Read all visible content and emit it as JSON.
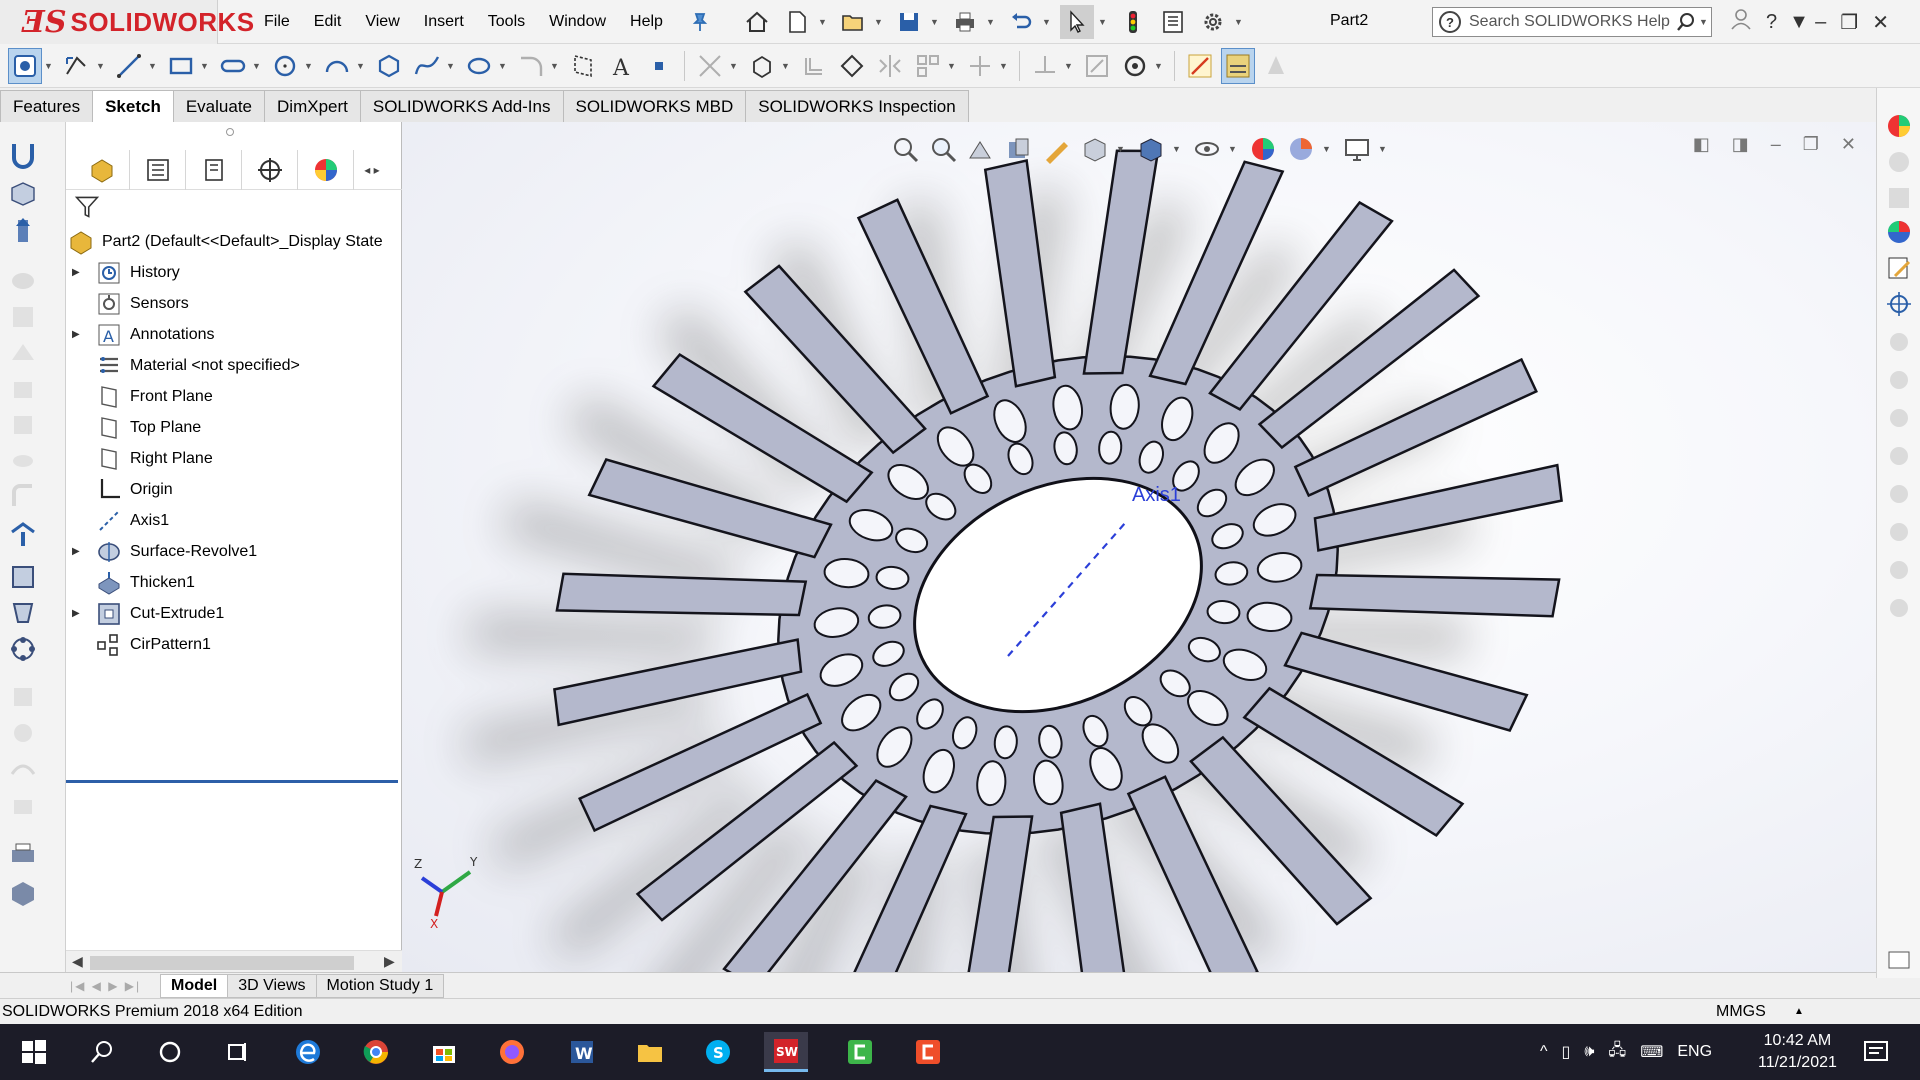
{
  "app": {
    "brand": "SOLIDWORKS",
    "document": "Part2",
    "search_placeholder": "Search SOLIDWORKS Help"
  },
  "menu": [
    "File",
    "Edit",
    "View",
    "Insert",
    "Tools",
    "Window",
    "Help"
  ],
  "command_tabs": [
    {
      "label": "Features",
      "active": false
    },
    {
      "label": "Sketch",
      "active": true
    },
    {
      "label": "Evaluate",
      "active": false
    },
    {
      "label": "DimXpert",
      "active": false
    },
    {
      "label": "SOLIDWORKS Add-Ins",
      "active": false
    },
    {
      "label": "SOLIDWORKS MBD",
      "active": false
    },
    {
      "label": "SOLIDWORKS Inspection",
      "active": false
    }
  ],
  "tree": {
    "root": "Part2  (Default<<Default>_Display State",
    "items": [
      {
        "label": "History",
        "icon": "history-icon",
        "expandable": true
      },
      {
        "label": "Sensors",
        "icon": "sensors-icon",
        "expandable": false
      },
      {
        "label": "Annotations",
        "icon": "annotations-icon",
        "expandable": true
      },
      {
        "label": "Material <not specified>",
        "icon": "material-icon",
        "expandable": false
      },
      {
        "label": "Front Plane",
        "icon": "plane-icon",
        "expandable": false
      },
      {
        "label": "Top Plane",
        "icon": "plane-icon",
        "expandable": false
      },
      {
        "label": "Right Plane",
        "icon": "plane-icon",
        "expandable": false
      },
      {
        "label": "Origin",
        "icon": "origin-icon",
        "expandable": false
      },
      {
        "label": "Axis1",
        "icon": "axis-icon",
        "expandable": false
      },
      {
        "label": "Surface-Revolve1",
        "icon": "surface-revolve-icon",
        "expandable": true
      },
      {
        "label": "Thicken1",
        "icon": "thicken-icon",
        "expandable": false
      },
      {
        "label": "Cut-Extrude1",
        "icon": "cut-extrude-icon",
        "expandable": true
      },
      {
        "label": "CirPattern1",
        "icon": "circular-pattern-icon",
        "expandable": false
      }
    ]
  },
  "graphics": {
    "axis_label": "Axis1",
    "triad": {
      "x": "X",
      "y": "Y",
      "z": "Z"
    }
  },
  "bottom_tabs": [
    {
      "label": "Model",
      "active": true
    },
    {
      "label": "3D Views",
      "active": false
    },
    {
      "label": "Motion Study 1",
      "active": false
    }
  ],
  "status": {
    "edition": "SOLIDWORKS Premium 2018 x64 Edition",
    "units": "MMGS"
  },
  "taskbar": {
    "language": "ENG",
    "time": "10:42 AM",
    "date": "11/21/2021"
  },
  "colors": {
    "brand_red": "#d3232a",
    "model_face": "#b4b8cc",
    "axis_blue": "#2b3fd8",
    "selection_blue": "#2d5fa8"
  }
}
